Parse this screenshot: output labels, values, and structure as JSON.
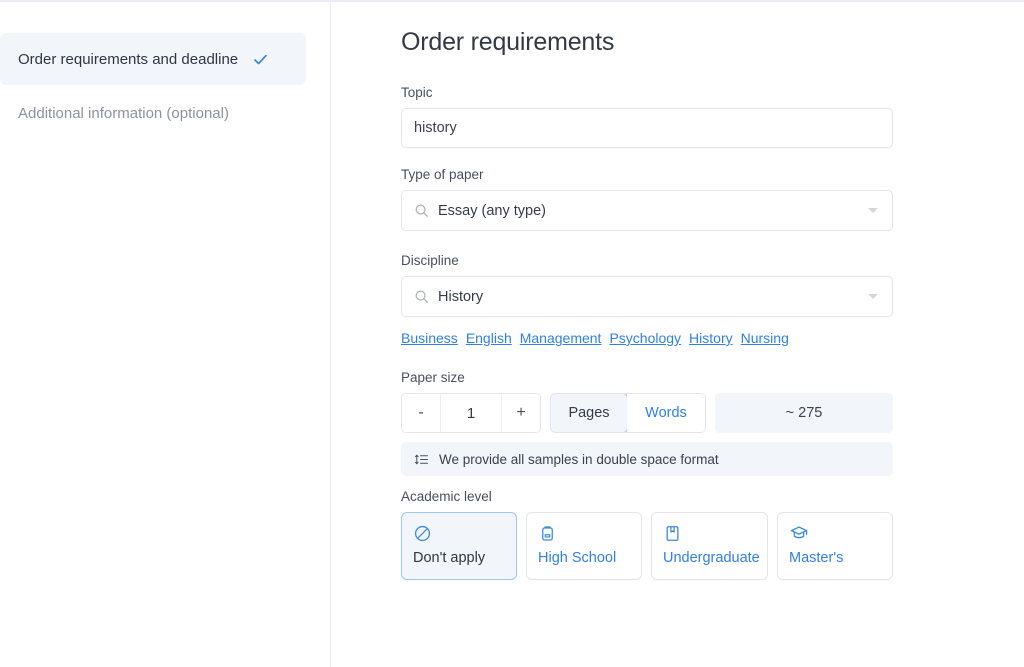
{
  "sidebar": {
    "items": [
      {
        "label": "Order requirements and deadline",
        "state": "active",
        "icon": "check-icon"
      },
      {
        "label": "Additional information (optional)",
        "state": "inactive",
        "icon": ""
      }
    ]
  },
  "main": {
    "title": "Order requirements",
    "topic": {
      "label": "Topic",
      "value": "history",
      "placeholder": "Topic"
    },
    "type_of_paper": {
      "label": "Type of paper",
      "value": "Essay (any type)",
      "icon": "search-icon",
      "caret": "chevron-down-icon"
    },
    "discipline": {
      "label": "Discipline",
      "value": "History",
      "icon": "search-icon",
      "caret": "chevron-down-icon",
      "quick_links": [
        "Business",
        "English",
        "Management",
        "Psychology",
        "History",
        "Nursing"
      ]
    },
    "paper_size": {
      "label": "Paper size",
      "decrement": "-",
      "quantity": "1",
      "increment": "+",
      "units": [
        {
          "label": "Pages",
          "selected": true
        },
        {
          "label": "Words",
          "selected": false
        }
      ],
      "approx_words": "~ 275",
      "note": "We provide all samples in double space format",
      "note_icon": "line-spacing-icon"
    },
    "academic_level": {
      "label": "Academic level",
      "options": [
        {
          "label": "Don't apply",
          "icon": "prohibited-icon",
          "selected": true
        },
        {
          "label": "High School",
          "icon": "backpack-icon",
          "selected": false
        },
        {
          "label": "Undergraduate",
          "icon": "book-bookmark-icon",
          "selected": false
        },
        {
          "label": "Master's",
          "icon": "graduation-cap-icon",
          "selected": false
        }
      ]
    }
  },
  "colors": {
    "accent": "#2f80ed",
    "selected_bg": "#f2f5fa",
    "selected_border": "#9fc5f3",
    "border": "#e2e6ec",
    "text": "#333a45",
    "muted": "#8b939f"
  }
}
